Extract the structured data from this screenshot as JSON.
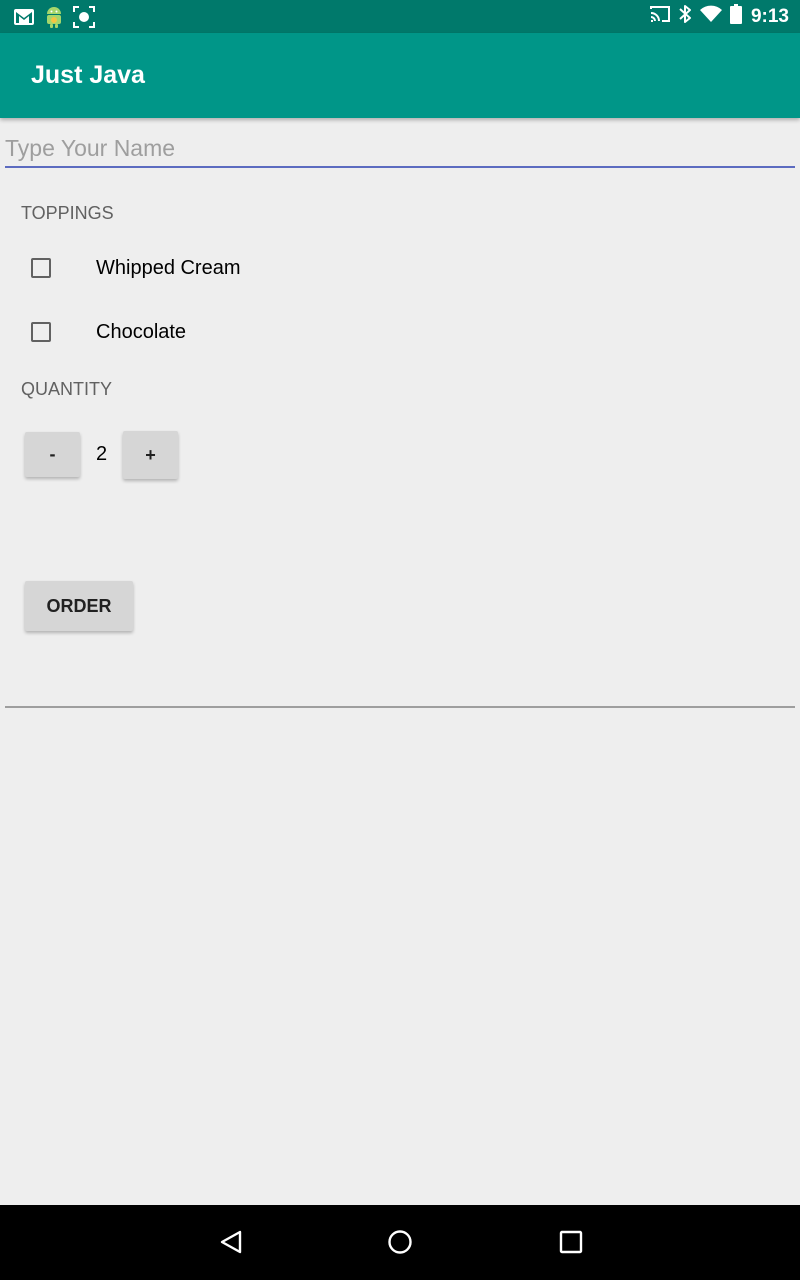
{
  "status_bar": {
    "time": "9:13",
    "left_icons": [
      "gmail-icon",
      "android-icon",
      "screenshot-icon"
    ],
    "right_icons": [
      "cast-icon",
      "bluetooth-icon",
      "wifi-icon",
      "battery-icon"
    ]
  },
  "app_bar": {
    "title": "Just Java",
    "color": "#009688"
  },
  "name_field": {
    "placeholder": "Type Your Name",
    "value": ""
  },
  "toppings": {
    "label": "TOPPINGS",
    "options": [
      {
        "label": "Whipped Cream",
        "checked": false
      },
      {
        "label": "Chocolate",
        "checked": false
      }
    ]
  },
  "quantity": {
    "label": "QUANTITY",
    "decrement_label": "-",
    "value": "2",
    "increment_label": "+"
  },
  "order_button": {
    "label": "ORDER"
  },
  "nav_bar": {
    "buttons": [
      "back-icon",
      "home-icon",
      "recents-icon"
    ]
  },
  "colors": {
    "status_bar": "#00796b",
    "accent": "#009688",
    "input_underline": "#5c6bc0",
    "background": "#eeeeee"
  }
}
